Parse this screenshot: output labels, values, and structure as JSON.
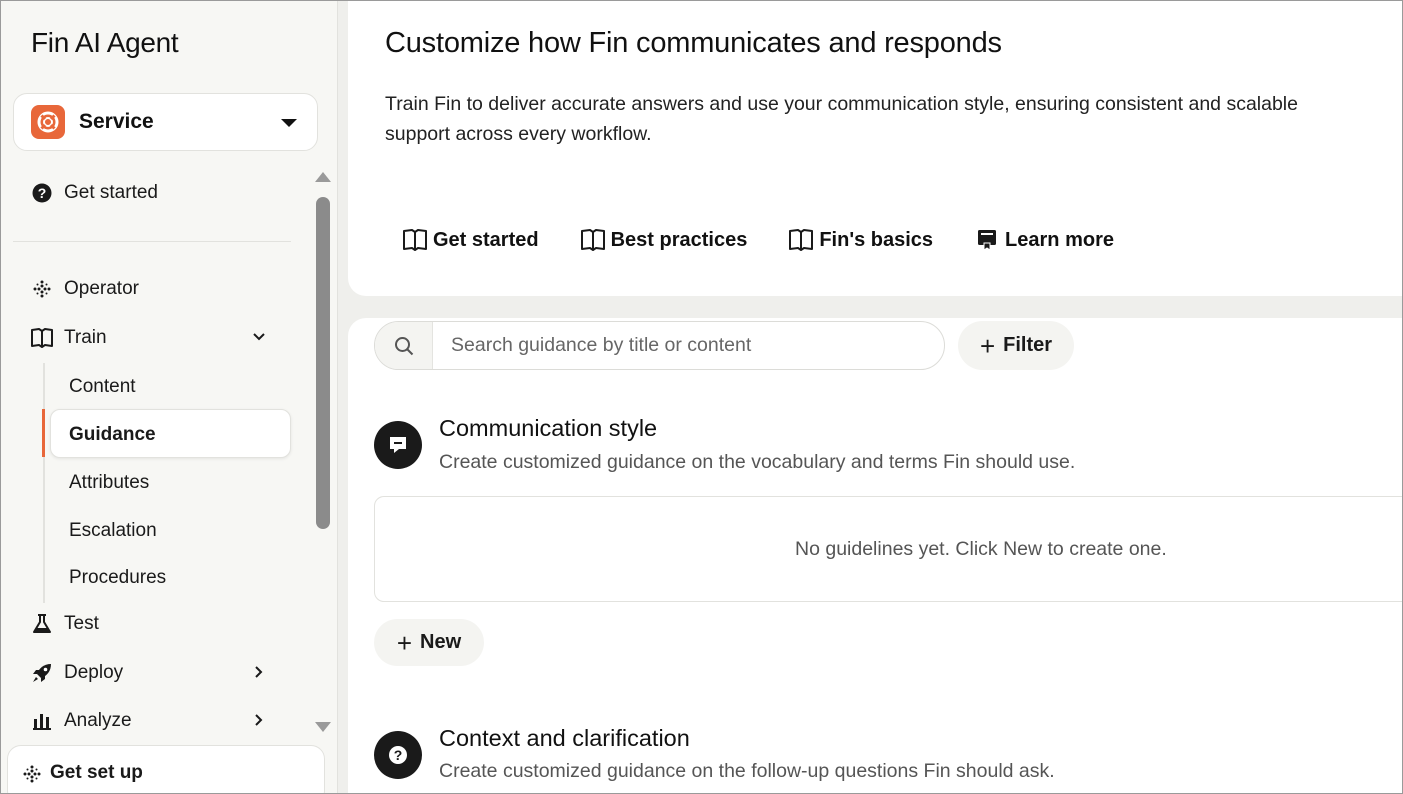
{
  "app": {
    "title": "Fin AI Agent"
  },
  "workspace": {
    "name": "Service",
    "icon": "lifebuoy-icon",
    "brand_color": "#e8673a"
  },
  "sidebar": {
    "get_started": "Get started",
    "items": [
      {
        "label": "Operator",
        "icon": "sparkle-dots-icon"
      },
      {
        "label": "Train",
        "icon": "book-icon",
        "expanded": true
      },
      {
        "label": "Test",
        "icon": "flask-icon"
      },
      {
        "label": "Deploy",
        "icon": "rocket-icon"
      },
      {
        "label": "Analyze",
        "icon": "bar-chart-icon"
      }
    ],
    "train_sub": [
      "Content",
      "Guidance",
      "Attributes",
      "Escalation",
      "Procedures"
    ],
    "active_sub": "Guidance",
    "setup": "Get set up"
  },
  "header": {
    "title": "Customize how Fin communicates and responds",
    "description": "Train Fin to deliver accurate answers and use your communication style, ensuring consistent and scalable support across every workflow.",
    "links": [
      {
        "label": "Get started",
        "icon": "book-open-icon"
      },
      {
        "label": "Best practices",
        "icon": "book-open-icon"
      },
      {
        "label": "Fin's basics",
        "icon": "book-open-icon"
      },
      {
        "label": "Learn more",
        "icon": "certificate-icon"
      }
    ]
  },
  "toolbar": {
    "search_placeholder": "Search guidance by title or content",
    "filter_label": "Filter"
  },
  "sections": [
    {
      "title": "Communication style",
      "description": "Create customized guidance on the vocabulary and terms Fin should use.",
      "empty_text": "No guidelines yet. Click New to create one.",
      "new_label": "New"
    },
    {
      "title": "Context and clarification",
      "description": "Create customized guidance on the follow-up questions Fin should ask."
    }
  ]
}
